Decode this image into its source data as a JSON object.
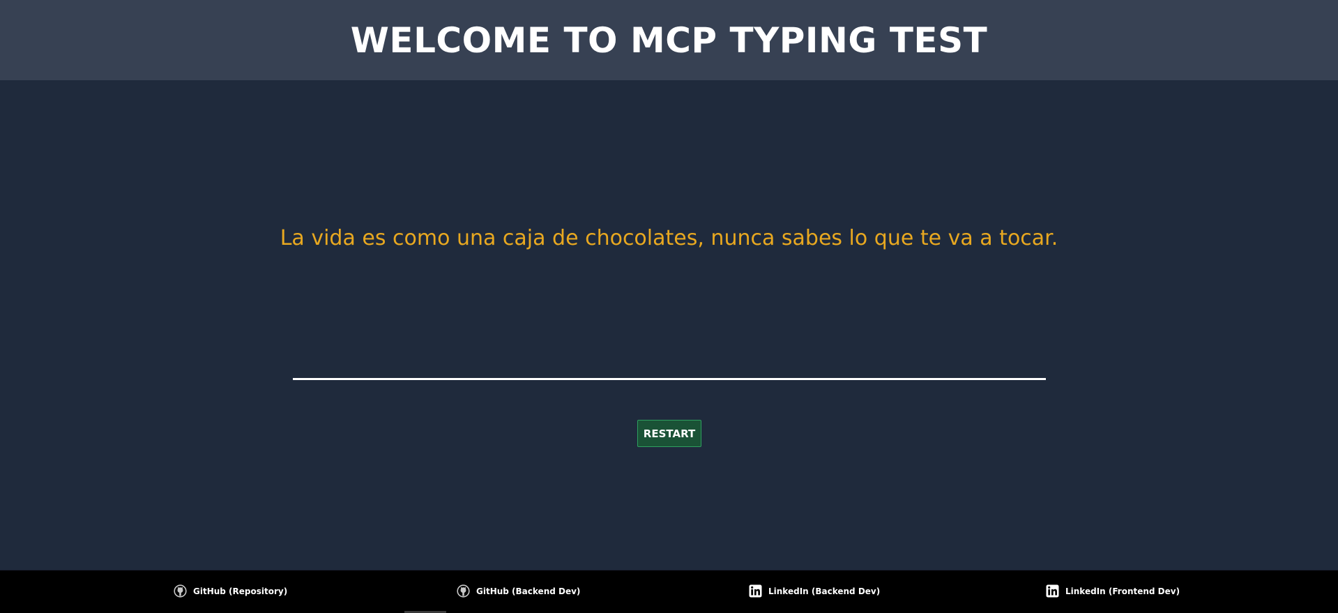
{
  "header": {
    "title": "WELCOME TO MCP TYPING TEST"
  },
  "main": {
    "phrase": "La vida es como una caja de chocolates, nunca sabes lo que te va a tocar.",
    "input_value": "",
    "restart_label": "RESTART"
  },
  "footer": {
    "links": [
      {
        "label": "GitHub (Repository)",
        "icon": "github-icon"
      },
      {
        "label": "GitHub (Backend Dev)",
        "icon": "github-icon"
      },
      {
        "label": "LinkedIn (Backend Dev)",
        "icon": "linkedin-icon"
      },
      {
        "label": "LinkedIn (Frontend Dev)",
        "icon": "linkedin-icon"
      }
    ]
  },
  "colors": {
    "header_bg": "#374153",
    "page_bg": "#1f2a3c",
    "phrase": "#e8a820",
    "button_bg": "#1a5236",
    "footer_bg": "#000000"
  }
}
